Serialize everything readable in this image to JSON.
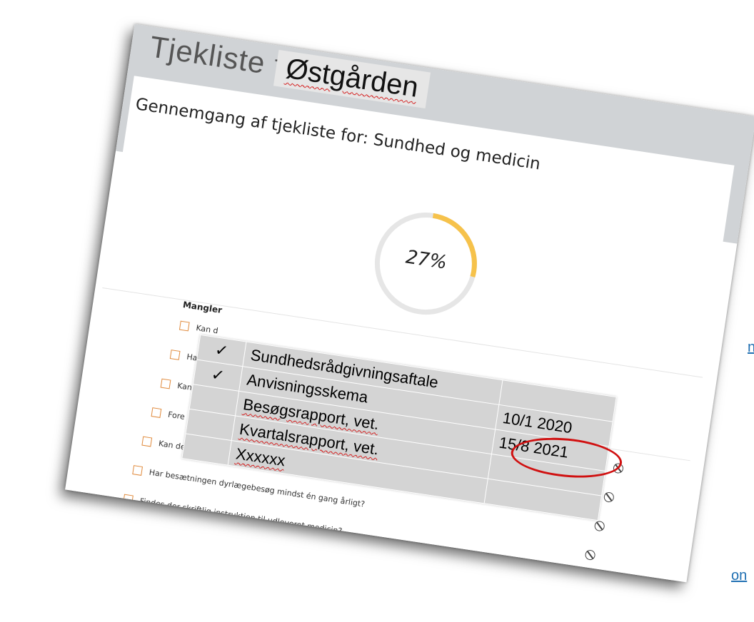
{
  "header": {
    "title_prefix": "Tjekliste for:",
    "farm_name": "Østgården"
  },
  "panel": {
    "heading": "Gennemgang af tjekliste for: Sundhed og medicin",
    "progress_label": "27%",
    "progress_fraction": 0.27,
    "section_title": "Mangler"
  },
  "questions": [
    {
      "text": "Kan d"
    },
    {
      "text": "Har b"
    },
    {
      "text": "Kan d"
    },
    {
      "text": "Fore"
    },
    {
      "text": "Kan der fremvises kvartalsrapporter for de sidste 12 måneder?"
    },
    {
      "text": "Har besætningen dyrlægebesøg mindst én gang årligt?"
    },
    {
      "text": "Findes der skriftlig instruktion til udleveret medicin?"
    }
  ],
  "overlay_table": {
    "rows": [
      {
        "check": "✓",
        "name": "Sundhedsrådgivningsaftale",
        "date": ""
      },
      {
        "check": "✓",
        "name": "Anvisningsskema",
        "date": "10/1 2020"
      },
      {
        "check": "",
        "name": "Besøgsrapport, vet.",
        "date": "15/8 2021"
      },
      {
        "check": "",
        "name": "Kvartalsrapport, vet.",
        "date": ""
      },
      {
        "check": "",
        "name": "Xxxxxx",
        "date": ""
      }
    ]
  },
  "edge_links": [
    "n",
    "on"
  ],
  "colors": {
    "progress": "#f6c24b",
    "track": "#e6e6e6",
    "check": "#2aa02a",
    "annotation_circle": "#d01010",
    "checkbox": "#e08a3c"
  }
}
